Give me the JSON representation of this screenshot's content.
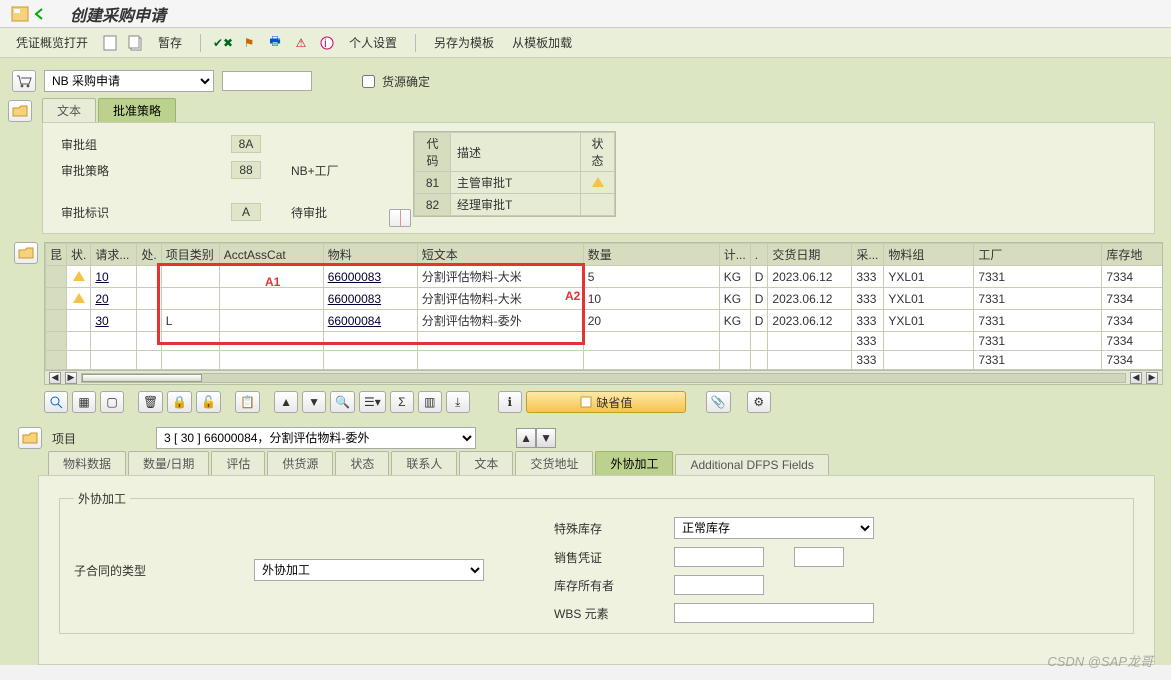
{
  "header": {
    "title": "创建采购申请"
  },
  "toolbar": {
    "voucher_preview": "凭证概览打开",
    "hold": "暂存",
    "personal_settings": "个人设置",
    "save_as_template": "另存为模板",
    "load_from_template": "从模板加载"
  },
  "doc_type_row": {
    "dropdown": "NB 采购申请",
    "req_num_placeholder": "",
    "source_determination": "货源确定"
  },
  "tabs_top": {
    "text": "文本",
    "release": "批准策略"
  },
  "release_form": {
    "group_label": "审批组",
    "group_value": "8A",
    "strategy_label": "审批策略",
    "strategy_value": "88",
    "strategy_text": "NB+工厂",
    "indicator_label": "审批标识",
    "indicator_value": "A",
    "indicator_text": "待审批"
  },
  "release_table": {
    "h_code": "代码",
    "h_desc": "描述",
    "h_status": "状态",
    "rows": [
      {
        "code": "81",
        "desc": "主管审批T",
        "tri": true
      },
      {
        "code": "82",
        "desc": "经理审批T",
        "tri": false
      }
    ]
  },
  "grid": {
    "cols": {
      "sel": "昆",
      "status": "状.",
      "req": "请求...",
      "proc": "处.",
      "itemcat": "项目类别",
      "acct": "AcctAssCat",
      "material": "物料",
      "shorttext": "短文本",
      "qty": "数量",
      "unit": "计...",
      "i": ".",
      "delivdate": "交货日期",
      "pg": "采...",
      "matgrp": "物料组",
      "plant": "工厂",
      "stloc": "库存地"
    },
    "rows": [
      {
        "st": "△",
        "req": "10",
        "itemcat": "",
        "acct": "",
        "mat": "66000083",
        "txt": "分割评估物料-大米",
        "qty": "5",
        "unit": "KG",
        "i": "D",
        "date": "2023.06.12",
        "pg": "333",
        "mg": "YXL01",
        "plant": "7331",
        "stloc": "7334"
      },
      {
        "st": "△",
        "req": "20",
        "itemcat": "",
        "acct": "",
        "mat": "66000083",
        "txt": "分割评估物料-大米",
        "qty": "10",
        "unit": "KG",
        "i": "D",
        "date": "2023.06.12",
        "pg": "333",
        "mg": "YXL01",
        "plant": "7331",
        "stloc": "7334"
      },
      {
        "st": "",
        "req": "30",
        "itemcat": "L",
        "acct": "",
        "mat": "66000084",
        "txt": "分割评估物料-委外",
        "qty": "20",
        "unit": "KG",
        "i": "D",
        "date": "2023.06.12",
        "pg": "333",
        "mg": "YXL01",
        "plant": "7331",
        "stloc": "7334"
      },
      {
        "st": "",
        "req": "",
        "itemcat": "",
        "acct": "",
        "mat": "",
        "txt": "",
        "qty": "",
        "unit": "",
        "i": "",
        "date": "",
        "pg": "333",
        "mg": "",
        "plant": "7331",
        "stloc": "7334"
      },
      {
        "st": "",
        "req": "",
        "itemcat": "",
        "acct": "",
        "mat": "",
        "txt": "",
        "qty": "",
        "unit": "",
        "i": "",
        "date": "",
        "pg": "333",
        "mg": "",
        "plant": "7331",
        "stloc": "7334"
      }
    ],
    "annotations": {
      "a1": "A1",
      "a2": "A2"
    }
  },
  "grid_toolbar": {
    "defaults": "缺省值"
  },
  "item_row": {
    "label": "项目",
    "dropdown": "3 [ 30 ] 66000084，分割评估物料-委外"
  },
  "bottom_tabs": {
    "t1": "物料数据",
    "t2": "数量/日期",
    "t3": "评估",
    "t4": "供货源",
    "t5": "状态",
    "t6": "联系人",
    "t7": "文本",
    "t8": "交货地址",
    "t9": "外协加工",
    "t10": "Additional DFPS Fields"
  },
  "subc_panel": {
    "legend": "外协加工",
    "contract_type_label": "子合同的类型",
    "contract_type_value": "外协加工",
    "special_stock_label": "特殊库存",
    "special_stock_value": "正常库存",
    "sales_doc_label": "销售凭证",
    "sales_doc_v1": "",
    "sales_doc_v2": "",
    "owner_label": "库存所有者",
    "owner_value": "",
    "wbs_label": "WBS 元素",
    "wbs_value": ""
  },
  "watermark": "CSDN @SAP龙哥"
}
